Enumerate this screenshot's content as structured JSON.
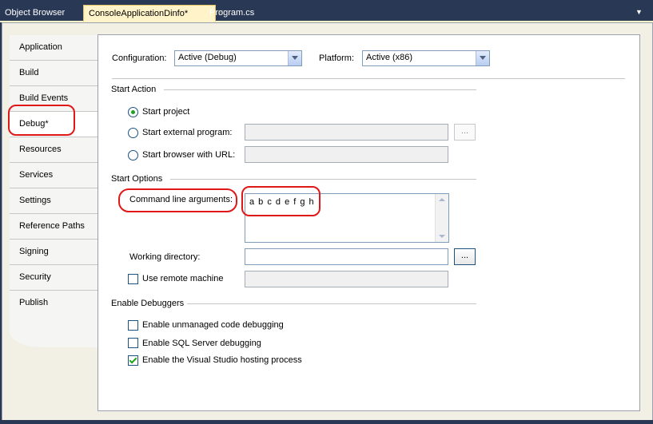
{
  "tabs": [
    {
      "label": "Object Browser"
    },
    {
      "label": "ConsoleApplicationDinfo*"
    },
    {
      "label": "Program.cs"
    }
  ],
  "tab_close_glyph": "✕",
  "tab_menu_glyph": "▼",
  "nav": [
    {
      "label": "Application"
    },
    {
      "label": "Build"
    },
    {
      "label": "Build Events"
    },
    {
      "label": "Debug*"
    },
    {
      "label": "Resources"
    },
    {
      "label": "Services"
    },
    {
      "label": "Settings"
    },
    {
      "label": "Reference Paths"
    },
    {
      "label": "Signing"
    },
    {
      "label": "Security"
    },
    {
      "label": "Publish"
    }
  ],
  "config": {
    "configuration_label": "Configuration:",
    "configuration_value": "Active (Debug)",
    "platform_label": "Platform:",
    "platform_value": "Active (x86)"
  },
  "start_action": {
    "header": "Start Action",
    "start_project": "Start project",
    "start_external": "Start external program:",
    "start_browser": "Start browser with URL:",
    "browse_label": "..."
  },
  "start_options": {
    "header": "Start Options",
    "cmd_args_label": "Command line arguments:",
    "cmd_args_value": "a b c d e f g h",
    "working_dir_label": "Working directory:",
    "working_dir_value": "",
    "browse_label": "...",
    "remote_label": "Use remote machine"
  },
  "debuggers": {
    "header": "Enable Debuggers",
    "unmanaged": "Enable unmanaged code debugging",
    "sql": "Enable SQL Server debugging",
    "hosting": "Enable the Visual Studio hosting process"
  },
  "colors": {
    "highlight": "#e01818",
    "chrome": "#293955",
    "active_tab": "#fff3c9"
  }
}
